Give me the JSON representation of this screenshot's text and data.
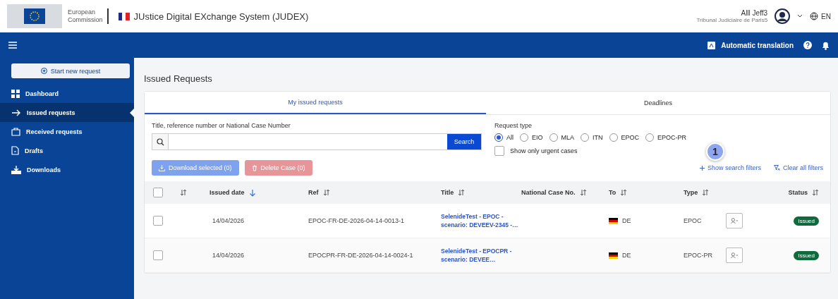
{
  "header": {
    "org_line_1": "European",
    "org_line_2": "Commission",
    "app_title": "JUstice Digital EXchange System (JUDEX)",
    "user_name": "Alll Jeff3",
    "user_org": "Tribunal Judiciaire de Paris5",
    "language": "EN"
  },
  "toolbar": {
    "translation_label": "Automatic translation"
  },
  "sidebar": {
    "new_request": "Start new request",
    "items": [
      {
        "label": "Dashboard",
        "selected": false
      },
      {
        "label": "Issued requests",
        "selected": true
      },
      {
        "label": "Received requests",
        "selected": false
      },
      {
        "label": "Drafts",
        "selected": false
      },
      {
        "label": "Downloads",
        "selected": false
      }
    ]
  },
  "page_title": "Issued Requests",
  "tabs": [
    {
      "label": "My issued requests",
      "selected": true
    },
    {
      "label": "Deadlines",
      "selected": false
    }
  ],
  "search": {
    "label": "Title, reference number or National Case Number",
    "button": "Search"
  },
  "request_type": {
    "label": "Request type",
    "options": [
      {
        "label": "All",
        "selected": true
      },
      {
        "label": "EIO",
        "selected": false
      },
      {
        "label": "MLA",
        "selected": false
      },
      {
        "label": "ITN",
        "selected": false
      },
      {
        "label": "EPOC",
        "selected": false
      },
      {
        "label": "EPOC-PR",
        "selected": false
      }
    ]
  },
  "urgent_filter": {
    "label": "Show only urgent cases",
    "checked": false
  },
  "step_badge": "1",
  "filter_links": [
    "Show search filters",
    "Clear all filters"
  ],
  "actions": [
    {
      "label": "Download selected (0)",
      "kind": "primary",
      "disabled": true
    },
    {
      "label": "Delete Case (0)",
      "kind": "danger",
      "disabled": true
    }
  ],
  "table": {
    "select_all": {
      "checked": false
    },
    "columns": [
      {
        "sorted": false
      },
      {
        "label": "Issued date",
        "sorted": true
      },
      {
        "label": "Ref",
        "sorted": false
      },
      {
        "label": "Title",
        "sorted": false
      },
      {
        "label": "National Case No.",
        "sorted": false
      },
      {
        "label": "To",
        "sorted": false
      },
      {
        "label": "Type",
        "sorted": false
      },
      {
        "label": "Status",
        "sorted": false
      }
    ],
    "rows": [
      {
        "checked": false,
        "issued_date": "14/04/2026",
        "ref": "EPOC-FR-DE-2026-04-14-0013-1",
        "title": "SelenideTest - EPOC - scenario: DEVEEV-2345 -…",
        "to": "DE",
        "type": "EPOC",
        "status": "Issued"
      },
      {
        "checked": false,
        "issued_date": "14/04/2026",
        "ref": "EPOCPR-FR-DE-2026-04-14-0024-1",
        "title": "SelenideTest - EPOCPR - scenario: DEVEE…",
        "to": "DE",
        "type": "EPOC-PR",
        "status": "Issued"
      }
    ]
  }
}
